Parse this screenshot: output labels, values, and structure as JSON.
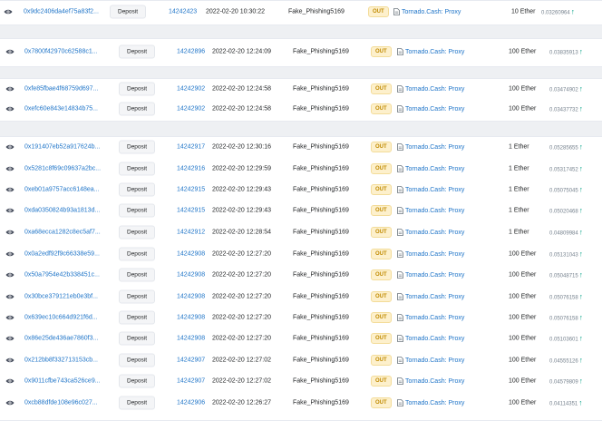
{
  "colors": {
    "link": "#1e74c8",
    "out_badge_bg": "#fdf0cc",
    "out_badge_text": "#c08a00",
    "fee_arrow": "#00a186"
  },
  "icons": {
    "view": "eye-icon",
    "contract": "document-icon",
    "fee_trend": "up-arrow-icon"
  },
  "transactions": [
    {
      "hash": "0x9dc2406da4ef75a83f2...",
      "method": "Deposit",
      "block": "14242423",
      "age": "2022-02-20 10:30:22",
      "from": "Fake_Phishing5169",
      "direction": "OUT",
      "to": "Tornado.Cash: Proxy",
      "value": "10 Ether",
      "fee": "0.03260964"
    },
    {
      "hash": "0x7800f42970c62588c1...",
      "method": "Deposit",
      "block": "14242896",
      "age": "2022-02-20 12:24:09",
      "from": "Fake_Phishing5169",
      "direction": "OUT",
      "to": "Tornado.Cash: Proxy",
      "value": "100 Ether",
      "fee": "0.03835913"
    },
    {
      "hash": "0xfe85fbae4f68759d697...",
      "method": "Deposit",
      "block": "14242902",
      "age": "2022-02-20 12:24:58",
      "from": "Fake_Phishing5169",
      "direction": "OUT",
      "to": "Tornado.Cash: Proxy",
      "value": "100 Ether",
      "fee": "0.03474902"
    },
    {
      "hash": "0xefc60e843e14834b75...",
      "method": "Deposit",
      "block": "14242902",
      "age": "2022-02-20 12:24:58",
      "from": "Fake_Phishing5169",
      "direction": "OUT",
      "to": "Tornado.Cash: Proxy",
      "value": "100 Ether",
      "fee": "0.03437732"
    },
    {
      "hash": "0x191407eb52a917624b...",
      "method": "Deposit",
      "block": "14242917",
      "age": "2022-02-20 12:30:16",
      "from": "Fake_Phishing5169",
      "direction": "OUT",
      "to": "Tornado.Cash: Proxy",
      "value": "1 Ether",
      "fee": "0.05285655"
    },
    {
      "hash": "0x5281c8f69c09637a2bc...",
      "method": "Deposit",
      "block": "14242916",
      "age": "2022-02-20 12:29:59",
      "from": "Fake_Phishing5169",
      "direction": "OUT",
      "to": "Tornado.Cash: Proxy",
      "value": "1 Ether",
      "fee": "0.05317452"
    },
    {
      "hash": "0xeb01a9757acc6148ea...",
      "method": "Deposit",
      "block": "14242915",
      "age": "2022-02-20 12:29:43",
      "from": "Fake_Phishing5169",
      "direction": "OUT",
      "to": "Tornado.Cash: Proxy",
      "value": "1 Ether",
      "fee": "0.05075045"
    },
    {
      "hash": "0xda0350824b93a1813d...",
      "method": "Deposit",
      "block": "14242915",
      "age": "2022-02-20 12:29:43",
      "from": "Fake_Phishing5169",
      "direction": "OUT",
      "to": "Tornado.Cash: Proxy",
      "value": "1 Ether",
      "fee": "0.05020468"
    },
    {
      "hash": "0xa68ecca1282c8ec5af7...",
      "method": "Deposit",
      "block": "14242912",
      "age": "2022-02-20 12:28:54",
      "from": "Fake_Phishing5169",
      "direction": "OUT",
      "to": "Tornado.Cash: Proxy",
      "value": "1 Ether",
      "fee": "0.04809984"
    },
    {
      "hash": "0x0a2edf92f9c66338e59...",
      "method": "Deposit",
      "block": "14242908",
      "age": "2022-02-20 12:27:20",
      "from": "Fake_Phishing5169",
      "direction": "OUT",
      "to": "Tornado.Cash: Proxy",
      "value": "100 Ether",
      "fee": "0.05131043"
    },
    {
      "hash": "0x50a7954e42b338451c...",
      "method": "Deposit",
      "block": "14242908",
      "age": "2022-02-20 12:27:20",
      "from": "Fake_Phishing5169",
      "direction": "OUT",
      "to": "Tornado.Cash: Proxy",
      "value": "100 Ether",
      "fee": "0.05048715"
    },
    {
      "hash": "0x30bce379121eb0e3bf...",
      "method": "Deposit",
      "block": "14242908",
      "age": "2022-02-20 12:27:20",
      "from": "Fake_Phishing5169",
      "direction": "OUT",
      "to": "Tornado.Cash: Proxy",
      "value": "100 Ether",
      "fee": "0.05076158"
    },
    {
      "hash": "0x639ec10c664d921f6d...",
      "method": "Deposit",
      "block": "14242908",
      "age": "2022-02-20 12:27:20",
      "from": "Fake_Phishing5169",
      "direction": "OUT",
      "to": "Tornado.Cash: Proxy",
      "value": "100 Ether",
      "fee": "0.05076158"
    },
    {
      "hash": "0x86e25de436ae7860f3...",
      "method": "Deposit",
      "block": "14242908",
      "age": "2022-02-20 12:27:20",
      "from": "Fake_Phishing5169",
      "direction": "OUT",
      "to": "Tornado.Cash: Proxy",
      "value": "100 Ether",
      "fee": "0.05103601"
    },
    {
      "hash": "0x212bb8f332713153cb...",
      "method": "Deposit",
      "block": "14242907",
      "age": "2022-02-20 12:27:02",
      "from": "Fake_Phishing5169",
      "direction": "OUT",
      "to": "Tornado.Cash: Proxy",
      "value": "100 Ether",
      "fee": "0.04555126"
    },
    {
      "hash": "0x9011cfbe743ca526ce9...",
      "method": "Deposit",
      "block": "14242907",
      "age": "2022-02-20 12:27:02",
      "from": "Fake_Phishing5169",
      "direction": "OUT",
      "to": "Tornado.Cash: Proxy",
      "value": "100 Ether",
      "fee": "0.04579809"
    },
    {
      "hash": "0xcb88dfde108e96c027...",
      "method": "Deposit",
      "block": "14242906",
      "age": "2022-02-20 12:26:27",
      "from": "Fake_Phishing5169",
      "direction": "OUT",
      "to": "Tornado.Cash: Proxy",
      "value": "100 Ether",
      "fee": "0.04114351"
    }
  ]
}
